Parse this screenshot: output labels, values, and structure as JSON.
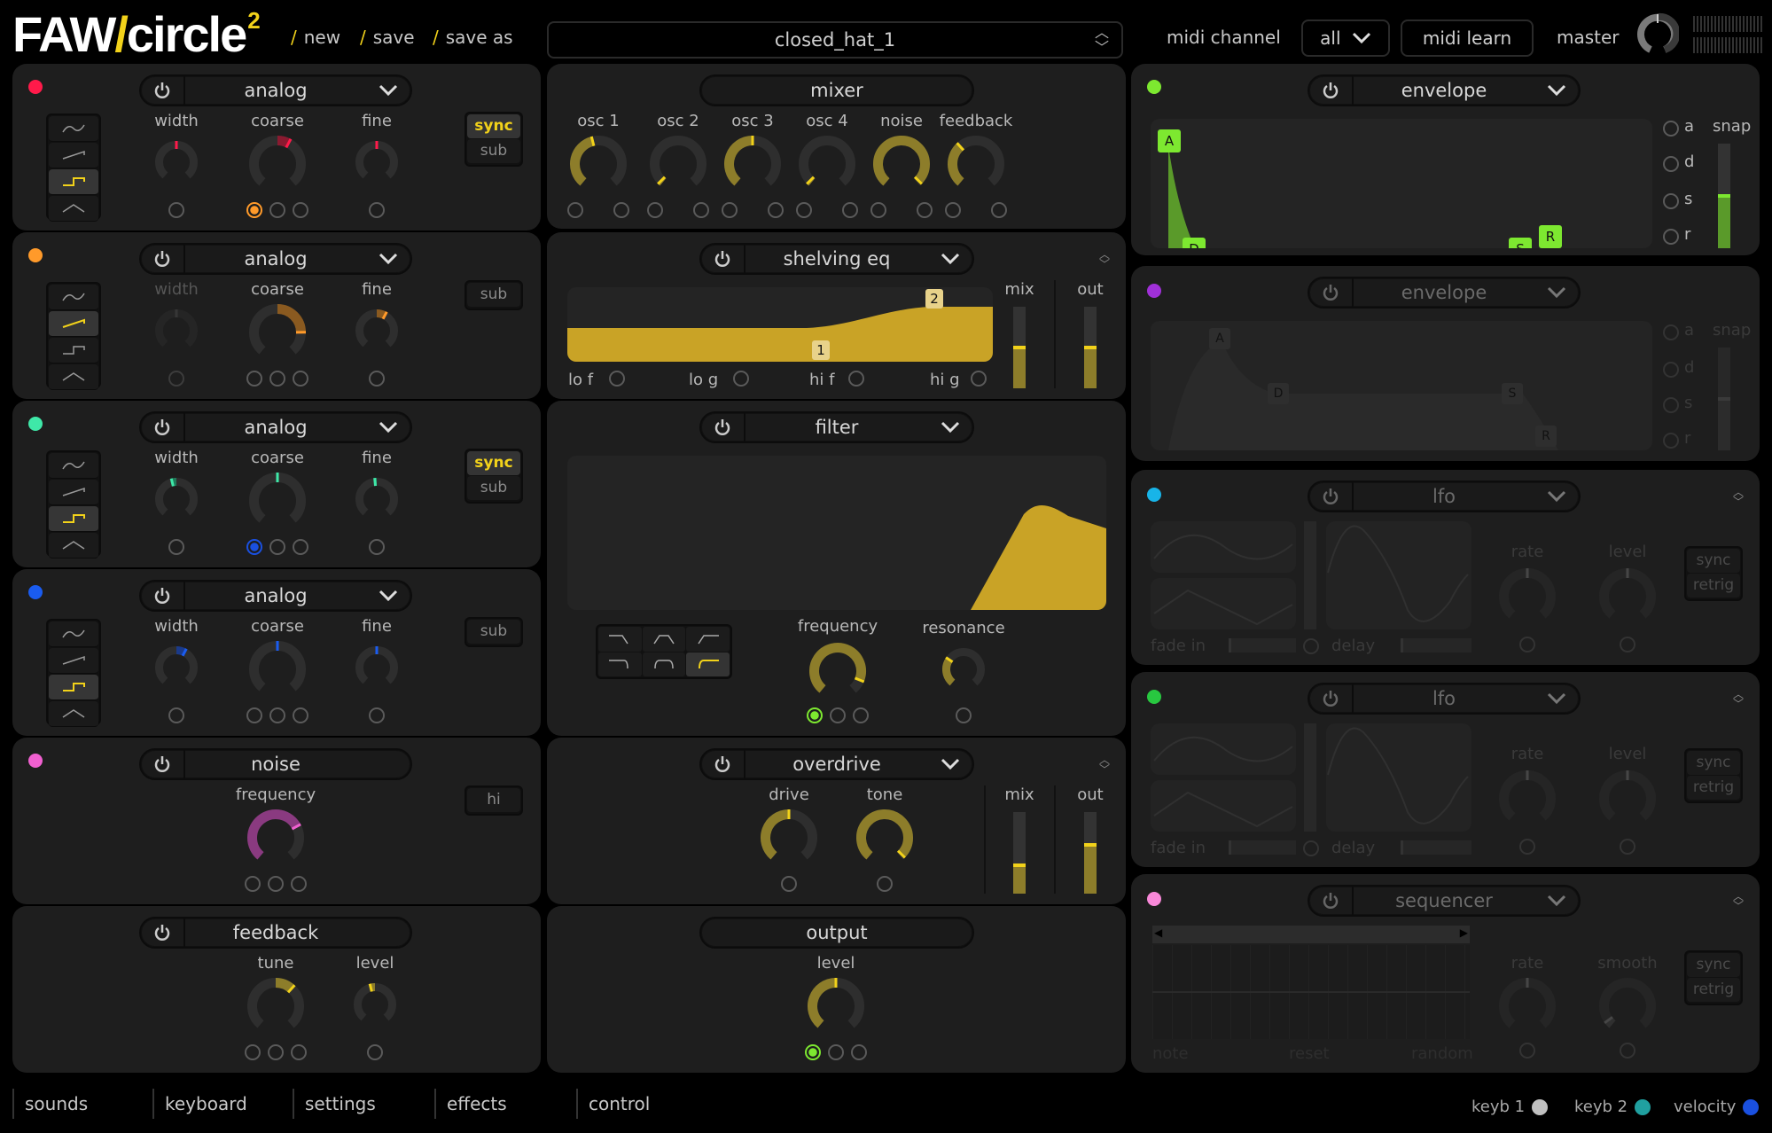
{
  "header": {
    "logo_main": "FAW",
    "logo_slash": "/",
    "logo_name": "circle",
    "logo_sup": "2",
    "links": [
      {
        "label": "new"
      },
      {
        "label": "save"
      },
      {
        "label": "save as"
      }
    ],
    "preset_name": "closed_hat_1",
    "midi_channel_label": "midi channel",
    "midi_channel_value": "all",
    "midi_learn_label": "midi learn",
    "master_label": "master",
    "master_level": 0.5
  },
  "colors": {
    "accent": "#f2d21a",
    "knob_fill": "#8d7d2a",
    "osc1": "#ff1a4a",
    "osc2": "#ff9a2a",
    "osc3": "#3fe8a8",
    "osc4": "#1a5cf0",
    "noise": "#f060d0",
    "env1": "#7de830",
    "env2": "#a030d8",
    "lfo1": "#18b4e8",
    "lfo2": "#28c840",
    "seq": "#f888d8",
    "keyb1": "#c0c0c0",
    "keyb2": "#20a0a0",
    "velocity": "#1a50e0"
  },
  "oscillators": [
    {
      "type": "analog",
      "waves_selected": 2,
      "knobs": [
        {
          "label": "width",
          "value": 0.5,
          "dim": false
        },
        {
          "label": "coarse",
          "value": 0.6,
          "dim": false
        },
        {
          "label": "fine",
          "value": 0.5,
          "dim": false
        }
      ],
      "toggles": [
        {
          "label": "sync",
          "on": true
        },
        {
          "label": "sub",
          "on": false
        }
      ]
    },
    {
      "type": "analog",
      "waves_selected": 1,
      "knobs": [
        {
          "label": "width",
          "value": 0.5,
          "dim": true
        },
        {
          "label": "coarse",
          "value": 0.82,
          "dim": false
        },
        {
          "label": "fine",
          "value": 0.6,
          "dim": false
        }
      ],
      "toggles": [
        {
          "label": "sub",
          "on": false
        }
      ]
    },
    {
      "type": "analog",
      "waves_selected": 2,
      "knobs": [
        {
          "label": "width",
          "value": 0.45,
          "dim": false
        },
        {
          "label": "coarse",
          "value": 0.5,
          "dim": false
        },
        {
          "label": "fine",
          "value": 0.48,
          "dim": false
        }
      ],
      "toggles": [
        {
          "label": "sync",
          "on": true
        },
        {
          "label": "sub",
          "on": false
        }
      ]
    },
    {
      "type": "analog",
      "waves_selected": 2,
      "knobs": [
        {
          "label": "width",
          "value": 0.6,
          "dim": false
        },
        {
          "label": "coarse",
          "value": 0.5,
          "dim": false
        },
        {
          "label": "fine",
          "value": 0.5,
          "dim": false
        }
      ],
      "toggles": [
        {
          "label": "sub",
          "on": false
        }
      ]
    }
  ],
  "noise": {
    "title": "noise",
    "knob_label": "frequency",
    "value": 0.72,
    "toggle": "hi"
  },
  "feedback": {
    "title": "feedback",
    "knobs": [
      {
        "label": "tune",
        "value": 0.65
      },
      {
        "label": "level",
        "value": 0.45
      }
    ]
  },
  "mixer": {
    "title": "mixer",
    "channels": [
      {
        "label": "osc 1",
        "value": 0.45
      },
      {
        "label": "osc 2",
        "value": 0.02
      },
      {
        "label": "osc 3",
        "value": 0.5
      },
      {
        "label": "osc 4",
        "value": 0.02
      },
      {
        "label": "noise",
        "value": 0.98
      },
      {
        "label": "feedback",
        "value": 0.35
      }
    ]
  },
  "shelving_eq": {
    "title": "shelving eq",
    "point_labels": [
      "1",
      "2"
    ],
    "params": [
      "lo f",
      "lo g",
      "hi f",
      "hi g"
    ],
    "mix_label": "mix",
    "out_label": "out",
    "mix": 0.5,
    "out": 0.5
  },
  "filter": {
    "title": "filter",
    "type_selected": 5,
    "knobs": [
      {
        "label": "frequency",
        "value": 0.9
      },
      {
        "label": "resonance",
        "value": 0.3
      }
    ]
  },
  "overdrive": {
    "title": "overdrive",
    "knobs": [
      {
        "label": "drive",
        "value": 0.5
      },
      {
        "label": "tone",
        "value": 0.98
      }
    ],
    "mix_label": "mix",
    "out_label": "out",
    "mix": 0.35,
    "out": 0.6
  },
  "output": {
    "title": "output",
    "knob_label": "level",
    "value": 0.5
  },
  "envelopes": [
    {
      "title": "envelope",
      "active": true,
      "points": [
        "A",
        "D",
        "S",
        "R"
      ],
      "radios": [
        "a",
        "d",
        "s",
        "r"
      ],
      "snap_label": "snap",
      "snap": 0.5
    },
    {
      "title": "envelope",
      "active": false,
      "points": [
        "A",
        "D",
        "S",
        "R"
      ],
      "radios": [
        "a",
        "d",
        "s",
        "r"
      ],
      "snap_label": "snap",
      "snap": 0.5
    }
  ],
  "lfos": [
    {
      "title": "lfo",
      "fade_label": "fade in",
      "delay_label": "delay",
      "knobs": [
        {
          "label": "rate",
          "value": 0.5
        },
        {
          "label": "level",
          "value": 0.5
        }
      ],
      "toggles": [
        "sync",
        "retrig"
      ]
    },
    {
      "title": "lfo",
      "fade_label": "fade in",
      "delay_label": "delay",
      "knobs": [
        {
          "label": "rate",
          "value": 0.5
        },
        {
          "label": "level",
          "value": 0.5
        }
      ],
      "toggles": [
        "sync",
        "retrig"
      ]
    }
  ],
  "sequencer": {
    "title": "sequencer",
    "footer": [
      "note",
      "reset",
      "random"
    ],
    "knobs": [
      {
        "label": "rate",
        "value": 0.5
      },
      {
        "label": "smooth",
        "value": 0.05
      }
    ],
    "toggles": [
      "sync",
      "retrig"
    ]
  },
  "bottom": {
    "tabs": [
      "sounds",
      "keyboard",
      "settings",
      "effects",
      "control"
    ],
    "legend": [
      {
        "label": "keyb 1"
      },
      {
        "label": "keyb 2"
      },
      {
        "label": "velocity"
      }
    ]
  }
}
